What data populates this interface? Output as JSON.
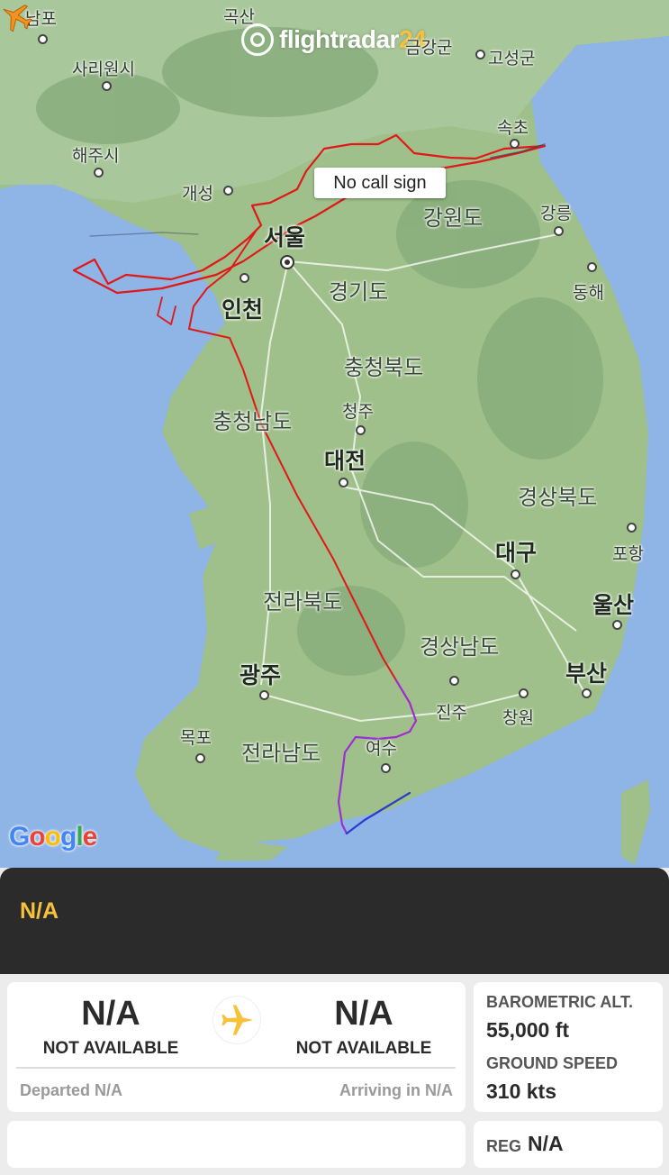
{
  "map": {
    "brand_text": "flightradar",
    "brand_num": "24",
    "google_letters": [
      "G",
      "o",
      "o",
      "g",
      "l",
      "e"
    ],
    "aircraft_label": "No call sign",
    "places": {
      "nampo": "남포",
      "goksan": "곡산",
      "geumgang": "금강군",
      "goseong": "고성군",
      "sariwon": "사리원시",
      "sokcho": "속초",
      "haeju": "해주시",
      "gaeseong": "개성",
      "gangwon": "강원도",
      "gangneung": "강릉",
      "seoul": "서울",
      "incheon": "인천",
      "gyeonggi": "경기도",
      "donghae": "동해",
      "chungbuk": "충청북도",
      "chungnam": "충청남도",
      "cheongju": "청주",
      "daejeon": "대전",
      "gyeongbuk": "경상북도",
      "pohang": "포항",
      "daegu": "대구",
      "jeonbuk": "전라북도",
      "ulsan": "울산",
      "gyeongnam": "경상남도",
      "gwangju": "광주",
      "busan": "부산",
      "jinju": "진주",
      "changwon": "창원",
      "mokpo": "목포",
      "jeonnam": "전라남도",
      "yeosu": "여수"
    }
  },
  "panel": {
    "flight_id": "N/A",
    "origin": {
      "code": "N/A",
      "name": "NOT AVAILABLE"
    },
    "destination": {
      "code": "N/A",
      "name": "NOT AVAILABLE"
    },
    "departed_text": "Departed N/A",
    "arriving_text": "Arriving in N/A",
    "stats": {
      "altitude_label": "BAROMETRIC ALT.",
      "altitude_value": "55,000 ft",
      "speed_label": "GROUND SPEED",
      "speed_value": "310 kts"
    },
    "reg_label": "REG",
    "reg_value": "N/A"
  },
  "colors": {
    "accent_yellow": "#f7c23a",
    "track_red": "#e01818",
    "track_purple": "#9b2fd6",
    "track_blue": "#2b3bd0",
    "header_dark": "#2b2b2b"
  }
}
